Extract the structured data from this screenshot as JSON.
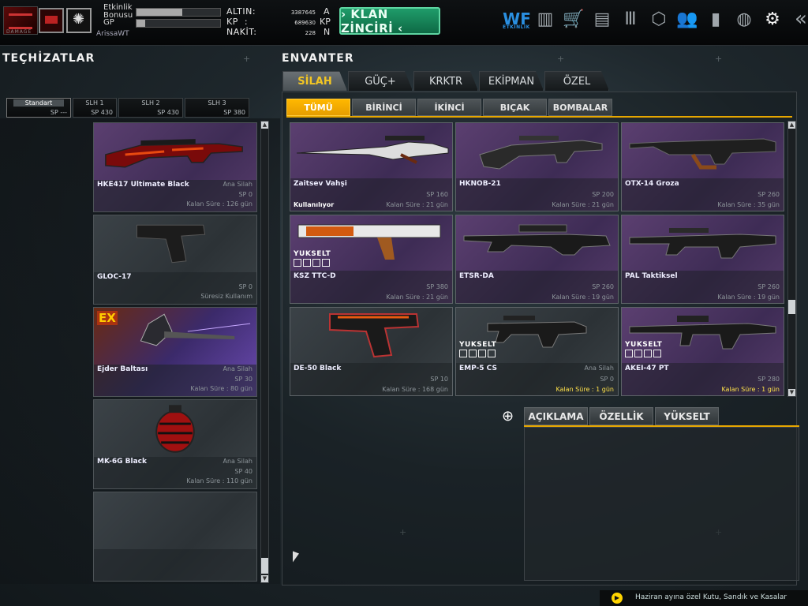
{
  "header": {
    "logo_text": "DAMAGE",
    "stats": [
      {
        "label": "Etkinlik Bonusu",
        "fill": 0.55
      },
      {
        "label": "GP",
        "fill": 0.1
      }
    ],
    "username": "ArissaWT",
    "currency": [
      {
        "label": "ALTIN:",
        "value": "3387645",
        "unit": "A"
      },
      {
        "label": "KP  :",
        "value": "689630",
        "unit": "KP"
      },
      {
        "label": "NAKİT:",
        "value": "228",
        "unit": "N"
      }
    ],
    "clan_button": "› KLAN ZİNCİRİ ‹",
    "icons": [
      {
        "name": "etkinlik-icon",
        "label": "ETKİNLİK"
      },
      {
        "name": "city-icon"
      },
      {
        "name": "shop-cart-icon"
      },
      {
        "name": "briefcase-icon"
      },
      {
        "name": "ammo-icon"
      },
      {
        "name": "box-icon"
      },
      {
        "name": "users-icon"
      },
      {
        "name": "bar-chart-icon"
      },
      {
        "name": "globe-icon"
      },
      {
        "name": "gear-icon"
      },
      {
        "name": "back-arrows-icon"
      }
    ]
  },
  "left": {
    "title": "TEÇHİZATLAR",
    "loadouts": [
      {
        "name": "Standart",
        "sp": "SP ---",
        "active": true
      },
      {
        "name": "SLH 1",
        "sp": "SP 430"
      },
      {
        "name": "SLH 2",
        "sp": "SP 430"
      },
      {
        "name": "SLH 3",
        "sp": "SP 380"
      }
    ],
    "items": [
      {
        "name": "HKE417 Ultimate Black",
        "type": "Ana Silah",
        "sp": "SP 0",
        "time": "Kalan Süre : 126 gün",
        "bg": "purple"
      },
      {
        "name": "GLOC-17",
        "type": "",
        "sp": "SP 0",
        "time": "Süresiz Kullanım",
        "bg": "grey"
      },
      {
        "name": "Ejder Baltası",
        "type": "Ana Silah",
        "sp": "SP 30",
        "time": "Kalan Süre : 80 gün",
        "bg": "purple",
        "badge": "EX"
      },
      {
        "name": "MK-6G Black",
        "type": "Ana Silah",
        "sp": "SP 40",
        "time": "Kalan Süre : 110 gün",
        "bg": "grey"
      },
      {
        "name": "",
        "type": "",
        "sp": "",
        "time": "",
        "bg": "grey"
      }
    ]
  },
  "inventory": {
    "title": "ENVANTER",
    "tabs": [
      "SİLAH",
      "GÜÇ+",
      "KRKTR",
      "EKİPMAN",
      "ÖZEL"
    ],
    "active_tab": "SİLAH",
    "subtabs": [
      "TÜMÜ",
      "BİRİNCİ",
      "İKİNCİ",
      "BIÇAK",
      "BOMBALAR"
    ],
    "active_subtab": "TÜMÜ",
    "items": [
      {
        "name": "Zaitsev Vahşi",
        "type": "",
        "sp": "SP 160",
        "time": "Kalan Süre : 21 gün",
        "status": "Kullanılıyor",
        "bg": "purple"
      },
      {
        "name": "HKNOB-21",
        "type": "",
        "sp": "SP 200",
        "time": "Kalan Süre : 21 gün",
        "bg": "purple"
      },
      {
        "name": "OTX-14 Groza",
        "type": "",
        "sp": "SP 260",
        "time": "Kalan Süre : 35 gün",
        "bg": "purple"
      },
      {
        "name": "KSZ TTC-D",
        "type": "",
        "sp": "SP 380",
        "time": "Kalan Süre : 21 gün",
        "upgrade": "YUKSELT",
        "bg": "purple"
      },
      {
        "name": "ETSR-DA",
        "type": "",
        "sp": "SP 260",
        "time": "Kalan Süre : 19 gün",
        "bg": "purple"
      },
      {
        "name": "PAL Taktiksel",
        "type": "",
        "sp": "SP 260",
        "time": "Kalan Süre : 19 gün",
        "bg": "purple"
      },
      {
        "name": "DE-50 Black",
        "type": "",
        "sp": "SP 10",
        "time": "Kalan Süre : 168 gün",
        "bg": "grey"
      },
      {
        "name": "EMP-5 CS",
        "type": "Ana Silah",
        "sp": "SP 0",
        "time": "Kalan Süre : 1 gün",
        "upgrade": "YUKSELT",
        "time_warn": true,
        "bg": "grey"
      },
      {
        "name": "AKEI-47 PT",
        "type": "",
        "sp": "SP 280",
        "time": "Kalan Süre : 1 gün",
        "upgrade": "YUKSELT",
        "time_warn": true,
        "bg": "purple"
      }
    ],
    "detail_tabs": [
      "AÇIKLAMA",
      "ÖZELLİK",
      "YÜKSELT"
    ]
  },
  "ticker": {
    "text": "Haziran ayına özel Kutu, Sandık ve Kasalar"
  },
  "colors": {
    "accent": "#e6a600",
    "clan_button": "#1f9c6a",
    "active_tab_text": "#f3c623",
    "purple_card": "#4a3560",
    "grey_card": "#343b40"
  }
}
